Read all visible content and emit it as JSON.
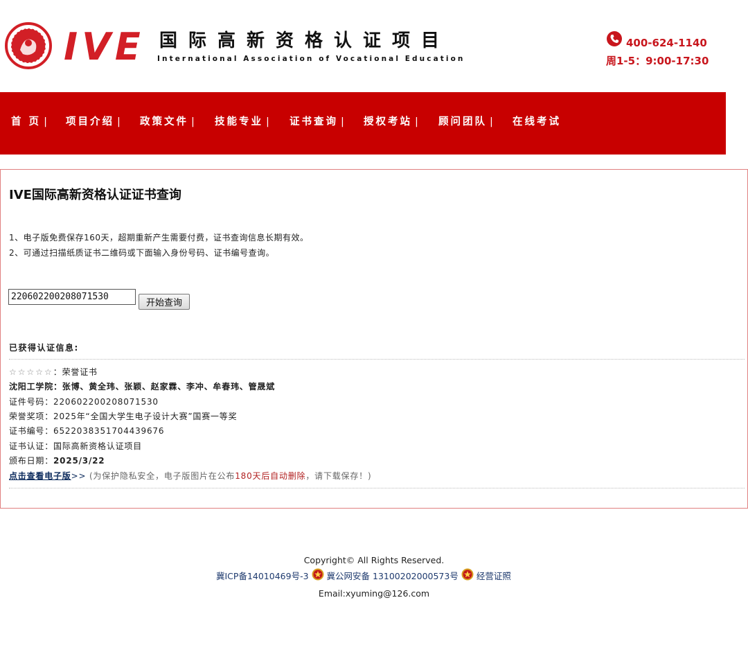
{
  "header": {
    "logo_text": "IVE",
    "title_cn": "国际高新资格认证项目",
    "title_en": "International Association of Vocational Education",
    "phone": "400-624-1140",
    "hours": "周1-5：9:00-17:30"
  },
  "nav": {
    "items": [
      {
        "label": "首 页"
      },
      {
        "label": "项目介绍"
      },
      {
        "label": "政策文件"
      },
      {
        "label": "技能专业"
      },
      {
        "label": "证书查询"
      },
      {
        "label": "授权考站"
      },
      {
        "label": "顾问团队"
      },
      {
        "label": "在线考试"
      }
    ],
    "separator": "|"
  },
  "main": {
    "title": "IVE国际高新资格认证证书查询",
    "notes": [
      "1、电子版免费保存160天，超期重新产生需要付费，证书查询信息长期有效。",
      "2、可通过扫描纸质证书二维码或下面输入身份号码、证书编号查询。"
    ],
    "search": {
      "value": "220602200208071530",
      "button_label": "开始查询"
    },
    "result": {
      "section_title": "已获得认证信息:",
      "stars": "☆☆☆☆☆",
      "cert_type_label": "：",
      "cert_type": "荣誉证书",
      "team": "沈阳工学院：张博、黄全玮、张颖、赵家霖、李冲、牟春玮、管晟斌",
      "id_label": "证件号码：",
      "id_value": "220602200208071530",
      "award_label": "荣誉奖项：",
      "award_value": "2025年“全国大学生电子设计大赛”国赛一等奖",
      "cert_no_label": "证书编号：",
      "cert_no_value": "6522038351704439676",
      "auth_label": "证书认证：",
      "auth_value": "国际高新资格认证项目",
      "date_label": "颁布日期：",
      "date_value": "2025/3/22",
      "view_link": "点击查看电子版",
      "view_arrow": ">>",
      "notice_prefix": "(为保护隐私安全，电子版图片在公布",
      "notice_red": "180天后自动删除",
      "notice_suffix": "，请下载保存！)"
    }
  },
  "footer": {
    "copyright": "Copyright© All Rights Reserved.",
    "icp": "冀ICP备14010469号-3",
    "police": "冀公网安备 13100202000573号",
    "license": "经营证照",
    "email": "Email:xyuming@126.com"
  },
  "colors": {
    "brand_red": "#c80000",
    "accent_red": "#c8161d",
    "link_blue": "#0b2a5c"
  }
}
